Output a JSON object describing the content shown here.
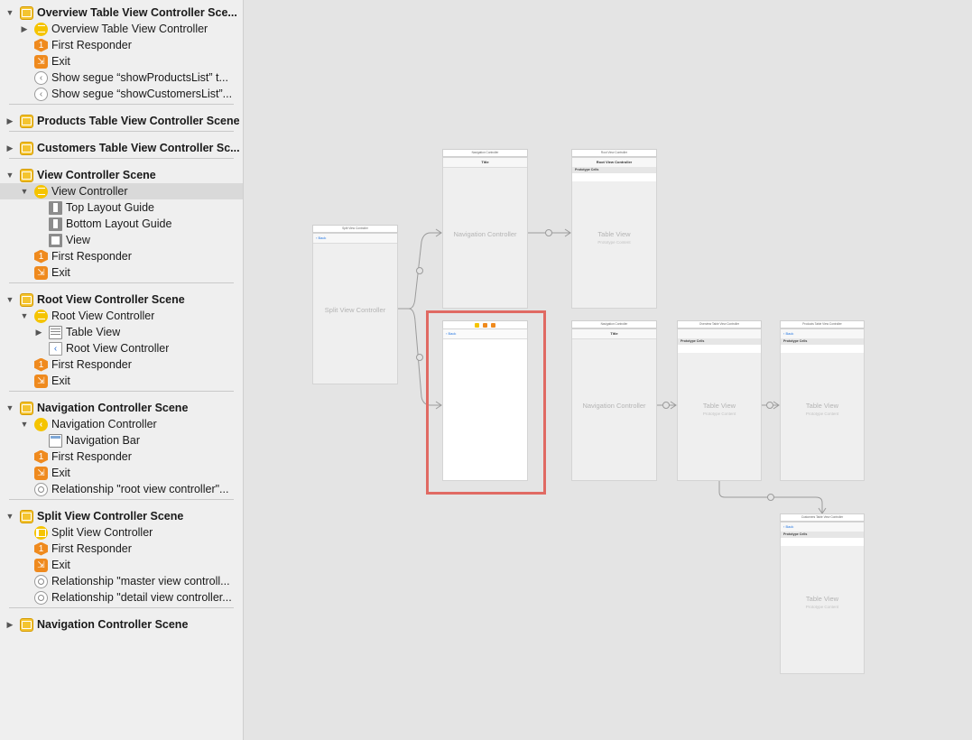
{
  "outline": {
    "rows": [
      {
        "label": "Overview Table View Controller Sce...",
        "kind": "scene",
        "icon": "scene-icon",
        "expanded": true
      },
      {
        "label": "Overview Table View Controller",
        "kind": "item",
        "icon": "view-controller-icon",
        "disclosure": "collapsed"
      },
      {
        "label": "First Responder",
        "kind": "item",
        "icon": "first-responder-icon"
      },
      {
        "label": "Exit",
        "kind": "item",
        "icon": "exit-icon"
      },
      {
        "label": "Show segue “showProductsList” t...",
        "kind": "item",
        "icon": "segue-icon"
      },
      {
        "label": "Show segue “showCustomersList”...",
        "kind": "item",
        "icon": "segue-icon"
      },
      {
        "label": "Products Table View Controller Scene",
        "kind": "scene",
        "icon": "scene-icon",
        "expanded": false
      },
      {
        "label": "Customers Table View Controller Sc...",
        "kind": "scene",
        "icon": "scene-icon",
        "expanded": false
      },
      {
        "label": "View Controller Scene",
        "kind": "scene",
        "icon": "scene-icon",
        "expanded": true
      },
      {
        "label": "View Controller",
        "kind": "item",
        "icon": "view-controller-icon",
        "disclosure": "expanded",
        "selected": true
      },
      {
        "label": "Top Layout Guide",
        "kind": "subitem",
        "icon": "layout-guide-icon"
      },
      {
        "label": "Bottom Layout Guide",
        "kind": "subitem",
        "icon": "layout-guide-icon"
      },
      {
        "label": "View",
        "kind": "subitem",
        "icon": "view-icon"
      },
      {
        "label": "First Responder",
        "kind": "item",
        "icon": "first-responder-icon"
      },
      {
        "label": "Exit",
        "kind": "item",
        "icon": "exit-icon"
      },
      {
        "label": "Root View Controller Scene",
        "kind": "scene",
        "icon": "scene-icon",
        "expanded": true
      },
      {
        "label": "Root View Controller",
        "kind": "item",
        "icon": "view-controller-icon",
        "disclosure": "expanded"
      },
      {
        "label": "Table View",
        "kind": "subitem",
        "icon": "table-view-icon",
        "disclosure": "collapsed"
      },
      {
        "label": "Root View Controller",
        "kind": "subitem",
        "icon": "back-item-icon"
      },
      {
        "label": "First Responder",
        "kind": "item",
        "icon": "first-responder-icon"
      },
      {
        "label": "Exit",
        "kind": "item",
        "icon": "exit-icon"
      },
      {
        "label": "Navigation Controller Scene",
        "kind": "scene",
        "icon": "scene-icon",
        "expanded": true
      },
      {
        "label": "Navigation Controller",
        "kind": "item",
        "icon": "navigation-controller-icon",
        "disclosure": "expanded"
      },
      {
        "label": "Navigation Bar",
        "kind": "subitem",
        "icon": "navigation-bar-icon"
      },
      {
        "label": "First Responder",
        "kind": "item",
        "icon": "first-responder-icon"
      },
      {
        "label": "Exit",
        "kind": "item",
        "icon": "exit-icon"
      },
      {
        "label": "Relationship \"root view controller\"...",
        "kind": "item",
        "icon": "relationship-icon"
      },
      {
        "label": "Split View Controller Scene",
        "kind": "scene",
        "icon": "scene-icon",
        "expanded": true
      },
      {
        "label": "Split View Controller",
        "kind": "item",
        "icon": "split-view-controller-icon"
      },
      {
        "label": "First Responder",
        "kind": "item",
        "icon": "first-responder-icon"
      },
      {
        "label": "Exit",
        "kind": "item",
        "icon": "exit-icon"
      },
      {
        "label": "Relationship \"master view controll...",
        "kind": "item",
        "icon": "relationship-icon"
      },
      {
        "label": "Relationship \"detail view controller...",
        "kind": "item",
        "icon": "relationship-icon"
      },
      {
        "label": "Navigation Controller Scene",
        "kind": "scene",
        "icon": "scene-icon",
        "expanded": false
      }
    ]
  },
  "canvas": {
    "split": {
      "header": "Split View Controller",
      "back": "Back",
      "center": "Split View Controller"
    },
    "nav_top": {
      "header": "Navigation Controller",
      "title": "Title",
      "center": "Navigation Controller"
    },
    "root": {
      "header": "Root View Controller",
      "title": "Root View Controller",
      "proto": "Prototype Cells",
      "center": "Table View",
      "sub": "Prototype Content"
    },
    "selected_vc": {
      "back": "Back"
    },
    "nav_bottom": {
      "header": "Navigation Controller",
      "title": "Title",
      "center": "Navigation Controller"
    },
    "overview": {
      "header": "Overview Table View Controller",
      "proto": "Prototype Cells",
      "center": "Table View",
      "sub": "Prototype Content"
    },
    "products": {
      "header": "Products Table View Controller",
      "back": "Back",
      "proto": "Prototype Cells",
      "center": "Table View",
      "sub": "Prototype Content"
    },
    "customers": {
      "header": "Customers Table View Controller",
      "back": "Back",
      "proto": "Prototype Cells",
      "center": "Table View",
      "sub": "Prototype Content"
    }
  },
  "colors": {
    "selection": "#e06a63",
    "link": "#2a7ae2",
    "scene_icon": "#f4c430",
    "responder_icon": "#ef8a1e"
  }
}
